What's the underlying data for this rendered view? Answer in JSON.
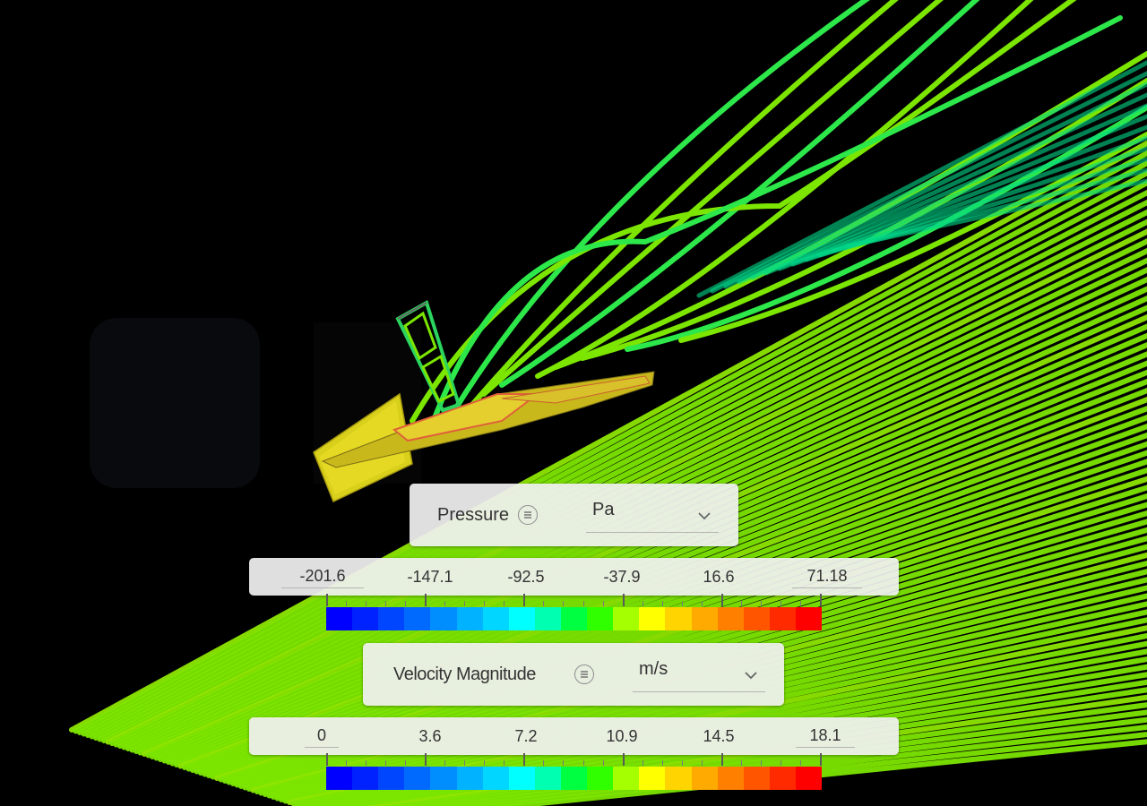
{
  "pressure": {
    "label": "Pressure",
    "info_icon": "list-icon",
    "unit": "Pa",
    "ticks": [
      "-201.6",
      "-147.1",
      "-92.5",
      "-37.9",
      "16.6",
      "71.18"
    ]
  },
  "velocity": {
    "label": "Velocity Magnitude",
    "info_icon": "list-icon",
    "unit": "m/s",
    "ticks": [
      "0",
      "3.6",
      "7.2",
      "10.9",
      "14.5",
      "18.1"
    ]
  },
  "colormap": [
    "#0000ff",
    "#0022ff",
    "#0046ff",
    "#006aff",
    "#008eff",
    "#00b2ff",
    "#00d6ff",
    "#00ffff",
    "#00ffb0",
    "#00ff40",
    "#30ff00",
    "#a6ff00",
    "#ffff00",
    "#ffd400",
    "#ffaa00",
    "#ff8000",
    "#ff5500",
    "#ff2a00",
    "#ff0000"
  ],
  "colors": {
    "background": "#000000",
    "streamline_main": "#7ce600",
    "streamline_fast": "#2de84a",
    "streamline_slow": "#00d98a",
    "model_body": "#d9d020"
  }
}
